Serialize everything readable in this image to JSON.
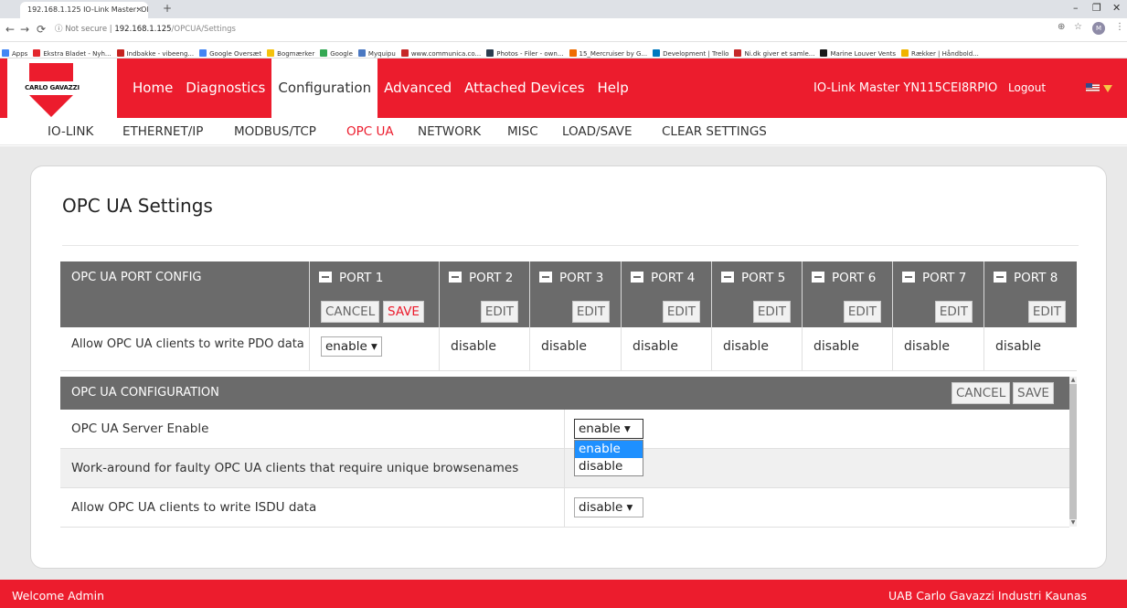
{
  "browser": {
    "tab_title": "192.168.1.125 IO-Link Master: OI",
    "tab_close": "×",
    "new_tab": "+",
    "security": "Not secure",
    "url_host": "192.168.1.125",
    "url_path": "/OPCUA/Settings",
    "bookmarks": [
      {
        "label": "Apps",
        "color": "#4285f4"
      },
      {
        "label": "Ekstra Bladet - Nyh...",
        "color": "#e3262c"
      },
      {
        "label": "Indbakke - vibeeng...",
        "color": "#c5221f"
      },
      {
        "label": "Google Oversæt",
        "color": "#4285f4"
      },
      {
        "label": "Bogmærker",
        "color": "#f4c20d"
      },
      {
        "label": "Google",
        "color": "#34a853"
      },
      {
        "label": "Myquipu",
        "color": "#4a78c2"
      },
      {
        "label": "www.communica.co...",
        "color": "#c62828"
      },
      {
        "label": "Photos - Filer - own...",
        "color": "#2c3e50"
      },
      {
        "label": "15_Mercruiser by G...",
        "color": "#ef6c00"
      },
      {
        "label": "Development | Trello",
        "color": "#0079bf"
      },
      {
        "label": "Ni.dk giver et samle...",
        "color": "#c62828"
      },
      {
        "label": "Marine Louver Vents",
        "color": "#1a1a1a"
      },
      {
        "label": "Rækker | Håndbold...",
        "color": "#f0b400"
      }
    ]
  },
  "header": {
    "logo_text": "CARLO GAVAZZI",
    "nav": [
      "Home",
      "Diagnostics",
      "Configuration",
      "Advanced",
      "Attached Devices",
      "Help"
    ],
    "active_nav": "Configuration",
    "device_title": "IO-Link Master YN115CEI8RPIO",
    "logout": "Logout"
  },
  "subnav": [
    "IO-LINK",
    "ETHERNET/IP",
    "MODBUS/TCP",
    "OPC UA",
    "NETWORK",
    "MISC",
    "LOAD/SAVE",
    "CLEAR SETTINGS"
  ],
  "page_title": "OPC UA Settings",
  "port_config": {
    "header": "OPC UA PORT CONFIG",
    "ports": [
      "PORT 1",
      "PORT 2",
      "PORT 3",
      "PORT 4",
      "PORT 5",
      "PORT 6",
      "PORT 7",
      "PORT 8"
    ],
    "cancel": "CANCEL",
    "save": "SAVE",
    "edit": "EDIT",
    "row_label": "Allow OPC UA clients to write PDO data",
    "port1_value": "enable",
    "values": [
      "disable",
      "disable",
      "disable",
      "disable",
      "disable",
      "disable",
      "disable"
    ]
  },
  "configuration": {
    "header": "OPC UA CONFIGURATION",
    "cancel": "CANCEL",
    "save": "SAVE",
    "rows": [
      {
        "label": "OPC UA Server Enable",
        "value": "enable"
      },
      {
        "label": "Work-around for faulty OPC UA clients that require unique browsenames",
        "value": "disable"
      },
      {
        "label": "Allow OPC UA clients to write ISDU data",
        "value": "disable"
      }
    ],
    "dropdown_options": [
      "enable",
      "disable"
    ]
  },
  "footer": {
    "left": "Welcome Admin",
    "right": "UAB Carlo Gavazzi Industri Kaunas"
  },
  "colors": {
    "brand_red": "#ec1c2d",
    "header_gray": "#6b6b6b",
    "selection_blue": "#1e90ff"
  }
}
